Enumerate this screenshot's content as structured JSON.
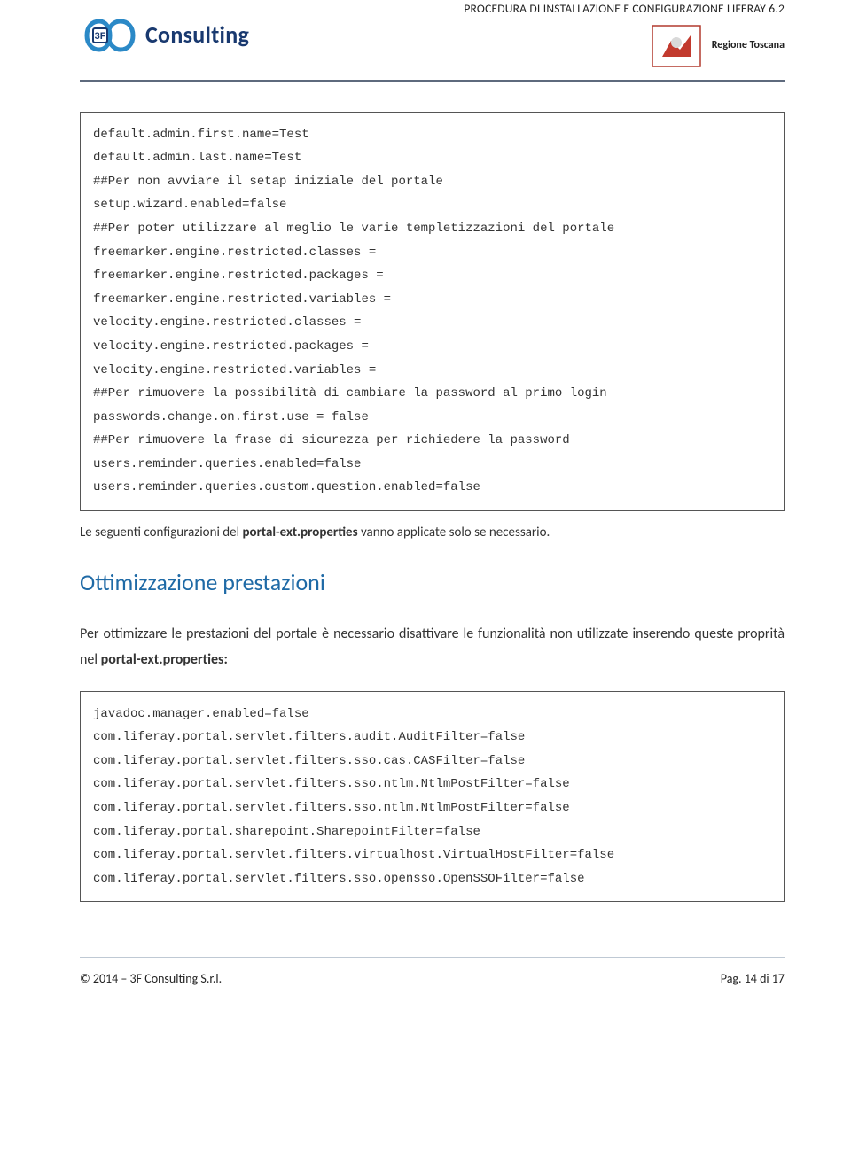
{
  "header": {
    "logo_brand": "Consulting",
    "doc_title": "PROCEDURA DI INSTALLAZIONE E CONFIGURAZIONE LIFERAY 6.2",
    "regione_label": "Regione Toscana"
  },
  "code1": {
    "lines": [
      "default.admin.first.name=Test",
      "default.admin.last.name=Test",
      "##Per non avviare il setap iniziale del portale",
      "setup.wizard.enabled=false",
      "##Per poter utilizzare al meglio le varie templetizzazioni del portale",
      "freemarker.engine.restricted.classes =",
      "freemarker.engine.restricted.packages =",
      "freemarker.engine.restricted.variables =",
      "velocity.engine.restricted.classes =",
      "velocity.engine.restricted.packages =",
      "velocity.engine.restricted.variables =",
      "##Per rimuovere la possibilità di cambiare la password al primo login",
      "passwords.change.on.first.use = false",
      "##Per rimuovere la frase di sicurezza per richiedere la password",
      "users.reminder.queries.enabled=false",
      "users.reminder.queries.custom.question.enabled=false"
    ]
  },
  "mid_para": {
    "prefix": "Le seguenti configurazioni del ",
    "bold": "portal-ext.properties",
    "suffix": " vanno applicate solo se necessario."
  },
  "section_heading": "Ottimizzazione prestazioni",
  "body_para": {
    "line1": "Per ottimizzare le prestazioni del portale è necessario disattivare le funzionalità non utilizzate inserendo queste proprità nel ",
    "bold": "portal-ext.properties:"
  },
  "code2": {
    "lines": [
      "javadoc.manager.enabled=false",
      "com.liferay.portal.servlet.filters.audit.AuditFilter=false",
      "com.liferay.portal.servlet.filters.sso.cas.CASFilter=false",
      "com.liferay.portal.servlet.filters.sso.ntlm.NtlmPostFilter=false",
      "com.liferay.portal.servlet.filters.sso.ntlm.NtlmPostFilter=false",
      "com.liferay.portal.sharepoint.SharepointFilter=false",
      "com.liferay.portal.servlet.filters.virtualhost.VirtualHostFilter=false",
      "com.liferay.portal.servlet.filters.sso.opensso.OpenSSOFilter=false"
    ]
  },
  "footer": {
    "left": "© 2014 – 3F Consulting S.r.l.",
    "right": "Pag. 14 di 17"
  }
}
